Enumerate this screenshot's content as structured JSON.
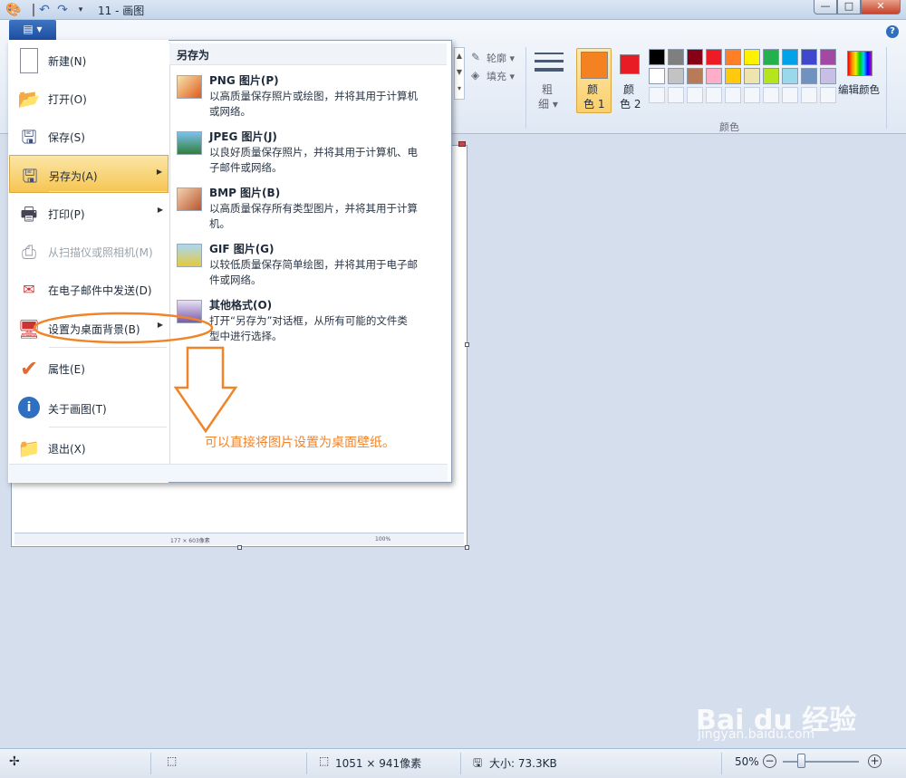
{
  "window": {
    "title": "11 - 画图",
    "min": "—",
    "max": "□",
    "close": "✕"
  },
  "ribbon": {
    "file_tab": "▤ ▾",
    "outline_label": "轮廓 ▾",
    "fill_label": "填充 ▾",
    "size_label_1": "粗",
    "size_label_2": "细 ▾",
    "color1_label_1": "颜",
    "color1_label_2": "色 1",
    "color2_label_1": "颜",
    "color2_label_2": "色 2",
    "edit_colors_label": "编辑颜色",
    "colors_group_label": "颜色",
    "color1": "#f58220",
    "color2": "#e81c24",
    "palette_row1": [
      "#000000",
      "#7f7f7f",
      "#880015",
      "#ed1c24",
      "#ff7f27",
      "#fff200",
      "#22b14c",
      "#00a2e8",
      "#3f48cc",
      "#a349a4"
    ],
    "palette_row2": [
      "#ffffff",
      "#c3c3c3",
      "#b97a57",
      "#ffaec9",
      "#ffc90e",
      "#efe4b0",
      "#b5e61d",
      "#99d9ea",
      "#7092be",
      "#c8bfe7"
    ]
  },
  "menu": {
    "items": [
      {
        "label": "新建(N)",
        "icon": "new-document-icon"
      },
      {
        "label": "打开(O)",
        "icon": "open-folder-icon"
      },
      {
        "label": "保存(S)",
        "icon": "save-disk-icon"
      },
      {
        "label": "另存为(A)",
        "icon": "save-as-icon"
      },
      {
        "label": "打印(P)",
        "icon": "printer-icon"
      },
      {
        "label": "从扫描仪或照相机(M)",
        "icon": "scanner-icon"
      },
      {
        "label": "在电子邮件中发送(D)",
        "icon": "email-icon"
      },
      {
        "label": "设置为桌面背景(B)",
        "icon": "desktop-background-icon"
      },
      {
        "label": "属性(E)",
        "icon": "checkmark-icon"
      },
      {
        "label": "关于画图(T)",
        "icon": "info-icon"
      },
      {
        "label": "退出(X)",
        "icon": "exit-icon"
      }
    ],
    "submenu_title": "另存为",
    "formats": [
      {
        "title": "PNG 图片(P)",
        "desc1": "以高质量保存照片或绘图，并将其用于计算机",
        "desc2": "或网络。"
      },
      {
        "title": "JPEG 图片(J)",
        "desc1": "以良好质量保存照片，并将其用于计算机、电",
        "desc2": "子邮件或网络。"
      },
      {
        "title": "BMP 图片(B)",
        "desc1": "以高质量保存所有类型图片，并将其用于计算",
        "desc2": "机。"
      },
      {
        "title": "GIF 图片(G)",
        "desc1": "以较低质量保存简单绘图，并将其用于电子邮",
        "desc2": "件或网络。"
      },
      {
        "title": "其他格式(O)",
        "desc1": "打开“另存为”对话框，从所有可能的文件类",
        "desc2": "型中进行选择。"
      }
    ]
  },
  "annotation": {
    "text": "可以直接将图片设置为桌面壁纸。"
  },
  "inner_doc": {
    "size": "177 × 603像素",
    "zoom": "100%"
  },
  "status": {
    "dimensions": "1051 × 941像素",
    "file_size": "大小: 73.3KB",
    "zoom": "50%"
  },
  "watermark": {
    "brand": "Bai du 经验",
    "url": "jingyan.baidu.com"
  }
}
